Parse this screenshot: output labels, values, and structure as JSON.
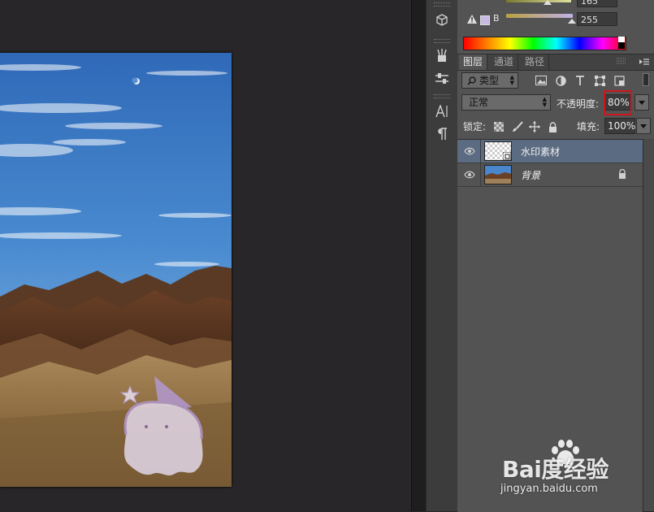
{
  "color_panel": {
    "top_value": "165",
    "b_label": "B",
    "b_value": "255"
  },
  "tabs": [
    {
      "label": "图层"
    },
    {
      "label": "通道"
    },
    {
      "label": "路径"
    }
  ],
  "filter": {
    "label": "类型"
  },
  "blend": {
    "mode": "正常",
    "opacity_label": "不透明度:",
    "opacity_value": "80%"
  },
  "lock": {
    "label": "锁定:",
    "fill_label": "填充:",
    "fill_value": "100%"
  },
  "layers": [
    {
      "name": "水印素材",
      "selected": true
    },
    {
      "name": "背景",
      "locked": true
    }
  ],
  "watermark": {
    "brand": "Bai度经验",
    "url": "jingyan.baidu.com"
  }
}
